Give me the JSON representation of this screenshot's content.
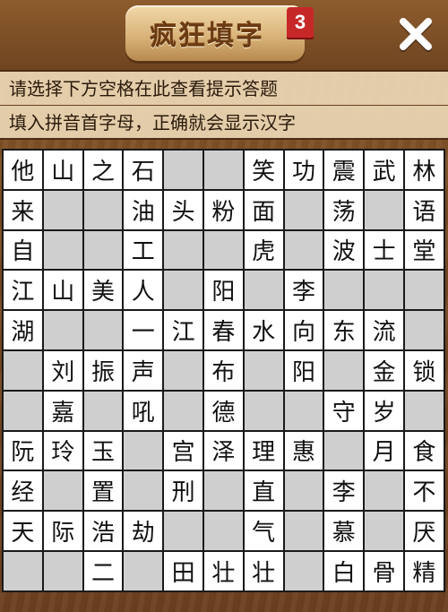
{
  "header": {
    "title": "疯狂填字",
    "level": "3",
    "close_icon": "close-icon"
  },
  "hints": {
    "line1": "请选择下方空格在此查看提示答题",
    "line2": "填入拼音首字母，正确就会显示汉字"
  },
  "grid": {
    "rows": [
      [
        "他",
        "山",
        "之",
        "石",
        "",
        "",
        "笑",
        "功",
        "震",
        "武",
        "林"
      ],
      [
        "来",
        "",
        "",
        "油",
        "头",
        "粉",
        "面",
        "",
        "荡",
        "",
        "语"
      ],
      [
        "自",
        "",
        "",
        "工",
        "",
        "",
        "虎",
        "",
        "波",
        "士",
        "堂"
      ],
      [
        "江",
        "山",
        "美",
        "人",
        "",
        "阳",
        "",
        "李",
        "",
        "",
        ""
      ],
      [
        "湖",
        "",
        "",
        "一",
        "江",
        "春",
        "水",
        "向",
        "东",
        "流",
        ""
      ],
      [
        "",
        "刘",
        "振",
        "声",
        "",
        "布",
        "",
        "阳",
        "",
        "金",
        "锁"
      ],
      [
        "",
        "嘉",
        "",
        "吼",
        "",
        "德",
        "",
        "",
        "守",
        "岁",
        ""
      ],
      [
        "阮",
        "玲",
        "玉",
        "",
        "宫",
        "泽",
        "理",
        "惠",
        "",
        "月",
        "食"
      ],
      [
        "经",
        "",
        "置",
        "",
        "刑",
        "",
        "直",
        "",
        "李",
        "",
        "不"
      ],
      [
        "天",
        "际",
        "浩",
        "劫",
        "",
        "",
        "气",
        "",
        "慕",
        "",
        "厌"
      ],
      [
        "",
        "",
        "二",
        "",
        "田",
        "壮",
        "壮",
        "",
        "白",
        "骨",
        "精"
      ]
    ]
  },
  "colors": {
    "blank_cell": "#cfcfcf",
    "letter_cell": "#ffffff",
    "badge": "#c62828"
  }
}
